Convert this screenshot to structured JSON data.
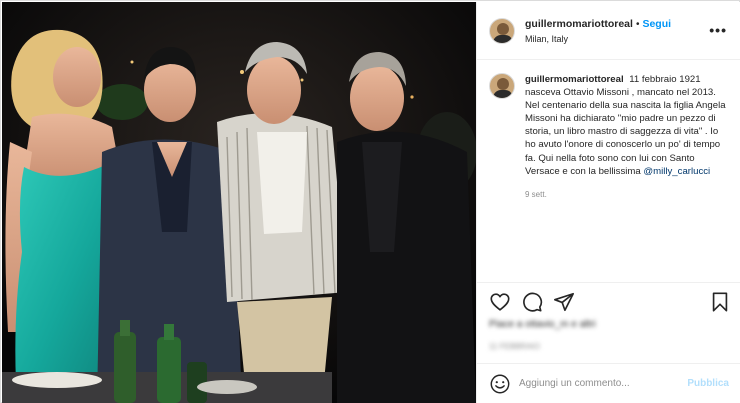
{
  "post": {
    "username": "guillermomariottoreal",
    "follow_label": "Segui",
    "separator": "•",
    "location": "Milan, Italy",
    "more_label": "•••",
    "caption_text": "11 febbraio 1921 nasceva Ottavio Missoni , mancato nel 2013. Nel centenario della sua nascita la figlia Angela Missoni ha dichiarato \"mio padre un pezzo di storia, un libro mastro di saggezza di vita\" . Io ho avuto l'onore di conoscerlo un po' di tempo fa. Qui nella foto sono con lui con Santo Versace e con la bellissima",
    "caption_mention": "@milly_carlucci",
    "time_ago": "9 sett.",
    "likes_text": "Piace a ottavio_m e altri",
    "date_text": "11 FEBBRAIO"
  },
  "comment": {
    "placeholder": "Aggiungi un commento...",
    "publish_label": "Pubblica"
  },
  "icons": {
    "like": "heart-icon",
    "comment": "comment-icon",
    "share": "share-icon",
    "save": "bookmark-icon",
    "emoji": "emoji-icon",
    "more": "more-options-icon"
  },
  "colors": {
    "accent": "#0095f6",
    "publish_disabled": "#b2dffc",
    "text": "#262626",
    "muted": "#8e8e8e"
  }
}
